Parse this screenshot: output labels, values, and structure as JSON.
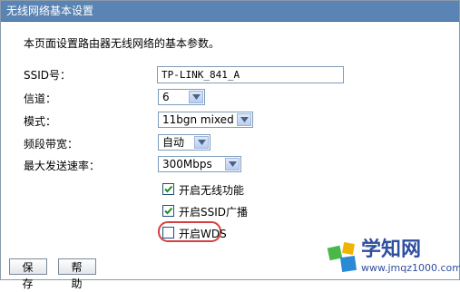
{
  "header": {
    "title": "无线网络基本设置"
  },
  "description": "本页面设置路由器无线网络的基本参数。",
  "fields": {
    "ssid": {
      "label": "SSID号：",
      "value": "TP-LINK_841_A"
    },
    "channel": {
      "label": "信道：",
      "value": "6"
    },
    "mode": {
      "label": "模式：",
      "value": "11bgn mixed"
    },
    "bandwidth": {
      "label": "频段带宽：",
      "value": "自动"
    },
    "max_rate": {
      "label": "最大发送速率：",
      "value": "300Mbps"
    }
  },
  "checkboxes": {
    "wireless": {
      "label": "开启无线功能",
      "checked": true
    },
    "ssid_broadcast": {
      "label": "开启SSID广播",
      "checked": true
    },
    "wds": {
      "label": "开启WDS",
      "checked": false
    }
  },
  "buttons": {
    "save": "保 存",
    "help": "帮 助"
  },
  "watermark": {
    "name": "学知网",
    "url": "www.jmqz1000.com"
  },
  "colors": {
    "title_bar": "#5a84b3",
    "highlight_ring": "#d44040"
  }
}
